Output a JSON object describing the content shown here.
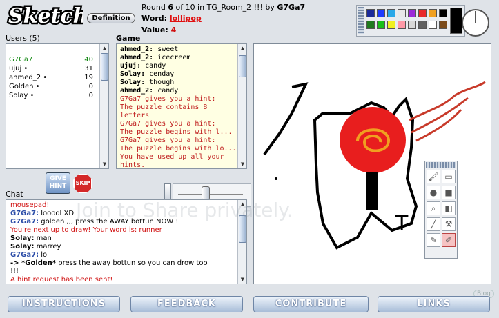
{
  "header": {
    "logo_text": "Sketch",
    "definition_label": "Definition",
    "round_label": "Round",
    "round_number": "6",
    "round_total_text": "of 10 in TG_Room_2 !!! by",
    "drawer": "G7Ga7",
    "word_label": "Word:",
    "word_value": "lollipop",
    "value_label": "Value:",
    "value_number": "4"
  },
  "palette": {
    "colors": [
      "#1a2a9a",
      "#1e3cff",
      "#2aa8e8",
      "#e8e8e8",
      "#9a2ad8",
      "#e82a2a",
      "#f0a020",
      "#000000",
      "#1f7a1f",
      "#18c018",
      "#f0f020",
      "#ff9aa8",
      "#d8d8d8",
      "#606060",
      "#ffffff",
      "#7a4a1a"
    ],
    "current_color": "#000000"
  },
  "users": {
    "heading": "Users (5)",
    "list": [
      {
        "name": "G7Ga7",
        "score": "40",
        "color": "#118811"
      },
      {
        "name": "ujuj •",
        "score": "31",
        "color": "#000000"
      },
      {
        "name": "ahmed_2 •",
        "score": "19",
        "color": "#000000"
      },
      {
        "name": "Golden •",
        "score": "0",
        "color": "#000000"
      },
      {
        "name": "Solay •",
        "score": "0",
        "color": "#000000"
      }
    ]
  },
  "game": {
    "heading": "Game",
    "lines": [
      {
        "who": "ahmed_2:",
        "text": " sweet"
      },
      {
        "who": "ahmed_2:",
        "text": " icecreem"
      },
      {
        "who": "ujuj:",
        "text": " candy"
      },
      {
        "who": "Solay:",
        "text": " cenday"
      },
      {
        "who": "Solay:",
        "text": " though"
      },
      {
        "who": "ahmed_2:",
        "text": " candy"
      },
      {
        "who": "",
        "text": "G7Ga7 gives you a hint:"
      },
      {
        "who": "",
        "text": "The puzzle contains 8"
      },
      {
        "who": "",
        "text": "letters"
      },
      {
        "who": "",
        "text": "G7Ga7 gives you a hint:"
      },
      {
        "who": "",
        "text": "The puzzle begins with l..."
      },
      {
        "who": "",
        "text": "G7Ga7 gives you a hint:"
      },
      {
        "who": "",
        "text": "The puzzle begins with lo..."
      },
      {
        "who": "",
        "text": "You have used up all your"
      },
      {
        "who": "",
        "text": "hints."
      }
    ]
  },
  "actions": {
    "give_hint_label": "GIVE HINT",
    "skip_label": "SKIP"
  },
  "chat": {
    "heading": "Chat",
    "lines": [
      {
        "who": "",
        "text": "mousepad!",
        "kind": "sys"
      },
      {
        "who": "G7Ga7:",
        "text": " looool XD",
        "kind": "name"
      },
      {
        "who": "G7Ga7:",
        "text": " golden ,,, press the AWAY bottun NOW !",
        "kind": "name"
      },
      {
        "who": "",
        "text": "You're next up to draw! Your word is: runner",
        "kind": "sys"
      },
      {
        "who": "Solay:",
        "text": " man",
        "kind": "bold"
      },
      {
        "who": "Solay:",
        "text": " marrey",
        "kind": "bold"
      },
      {
        "who": "G7Ga7:",
        "text": " lol",
        "kind": "name"
      },
      {
        "who": "-> *Golden*",
        "text": " press the away bottun so you can drow too",
        "kind": "bold"
      },
      {
        "who": "",
        "text": "!!!",
        "kind": "plain"
      },
      {
        "who": "",
        "text": "A hint request has been sent!",
        "kind": "sys"
      }
    ]
  },
  "watermark": "Join to Share privately.",
  "blog_mark": "Blog",
  "nav": {
    "instructions": "INSTRUCTIONS",
    "feedback": "FEEDBACK",
    "contribute": "CONTRIBUTE",
    "links": "LINKS"
  },
  "canvas_doodle_text": "T",
  "tools": [
    "brush-icon",
    "eraser-icon",
    "circle-icon",
    "square-icon",
    "magnifier-icon",
    "fill-bucket-icon",
    "line-icon",
    "hammer-icon",
    "pen-icon",
    "marker-icon"
  ]
}
